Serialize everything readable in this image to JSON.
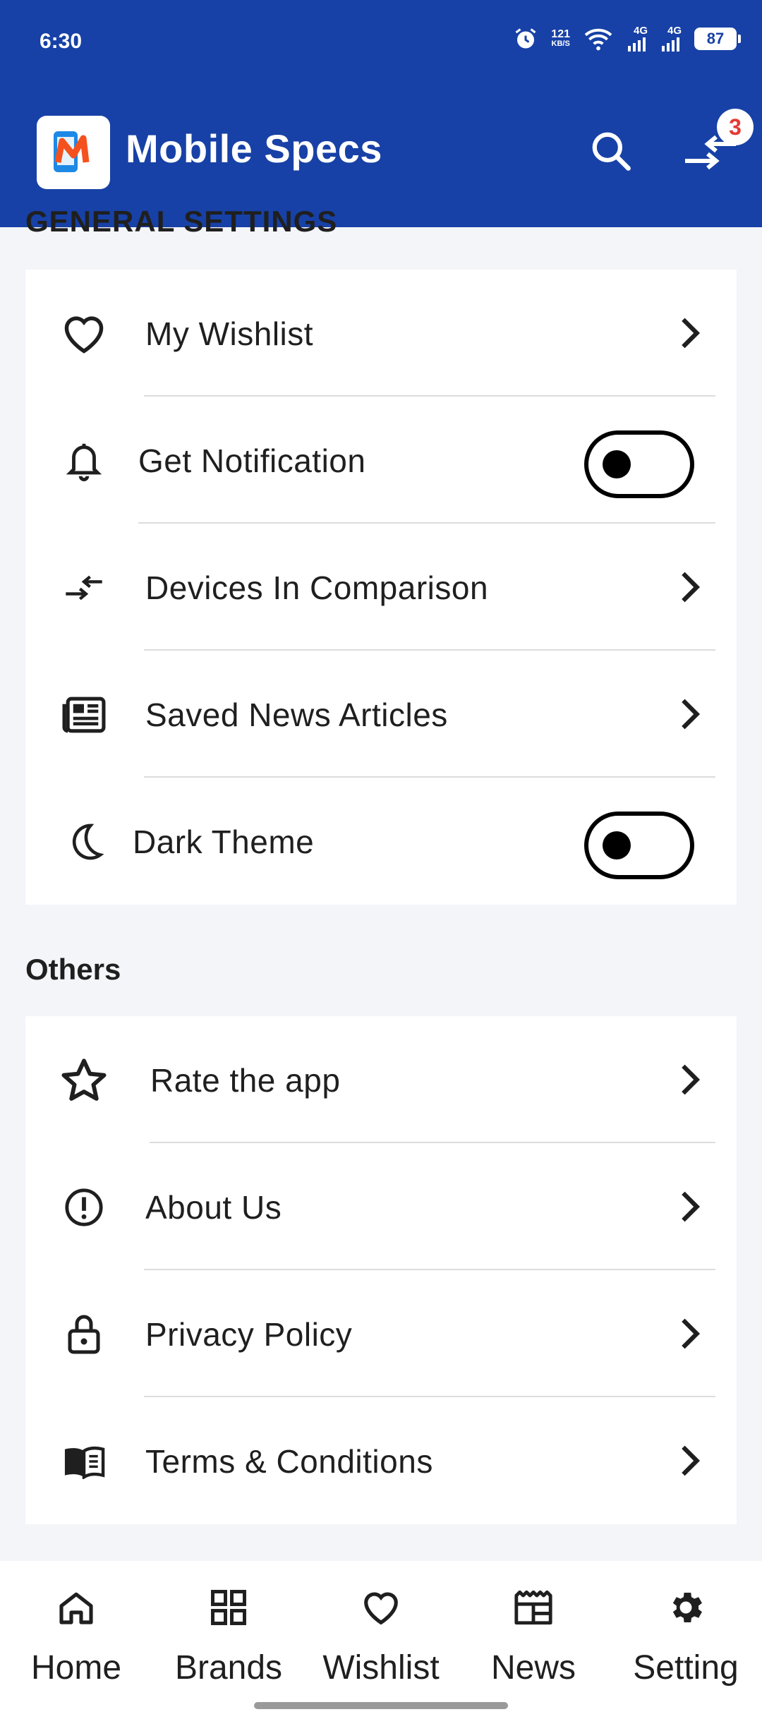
{
  "status_bar": {
    "time": "6:30",
    "speed_value": "121",
    "speed_unit": "KB/S",
    "network_1": "4G",
    "network_2": "4G",
    "battery": "87"
  },
  "header": {
    "app_name": "Mobile Specs",
    "logo_letter": "M",
    "compare_count": "3"
  },
  "general": {
    "title": "GENERAL SETTINGS",
    "items": [
      {
        "label": "My Wishlist",
        "icon": "heart-icon"
      },
      {
        "label": "Get Notification",
        "icon": "bell-icon",
        "toggle": false
      },
      {
        "label": "Devices In Comparison",
        "icon": "compare-icon"
      },
      {
        "label": "Saved News Articles",
        "icon": "newspaper-icon"
      },
      {
        "label": "Dark Theme",
        "icon": "moon-icon",
        "toggle": false
      }
    ]
  },
  "others": {
    "title": "Others",
    "items": [
      {
        "label": "Rate the app",
        "icon": "star-icon"
      },
      {
        "label": "About Us",
        "icon": "info-icon"
      },
      {
        "label": "Privacy Policy",
        "icon": "lock-icon"
      },
      {
        "label": "Terms & Conditions",
        "icon": "book-icon"
      }
    ]
  },
  "bottom_nav": {
    "items": [
      {
        "label": "Home",
        "icon": "home-icon"
      },
      {
        "label": "Brands",
        "icon": "grid-icon"
      },
      {
        "label": "Wishlist",
        "icon": "heart-icon"
      },
      {
        "label": "News",
        "icon": "news-icon"
      },
      {
        "label": "Setting",
        "icon": "gear-icon"
      }
    ]
  },
  "colors": {
    "primary": "#1741a6",
    "badge_text": "#e53935",
    "background": "#f4f5f9"
  }
}
